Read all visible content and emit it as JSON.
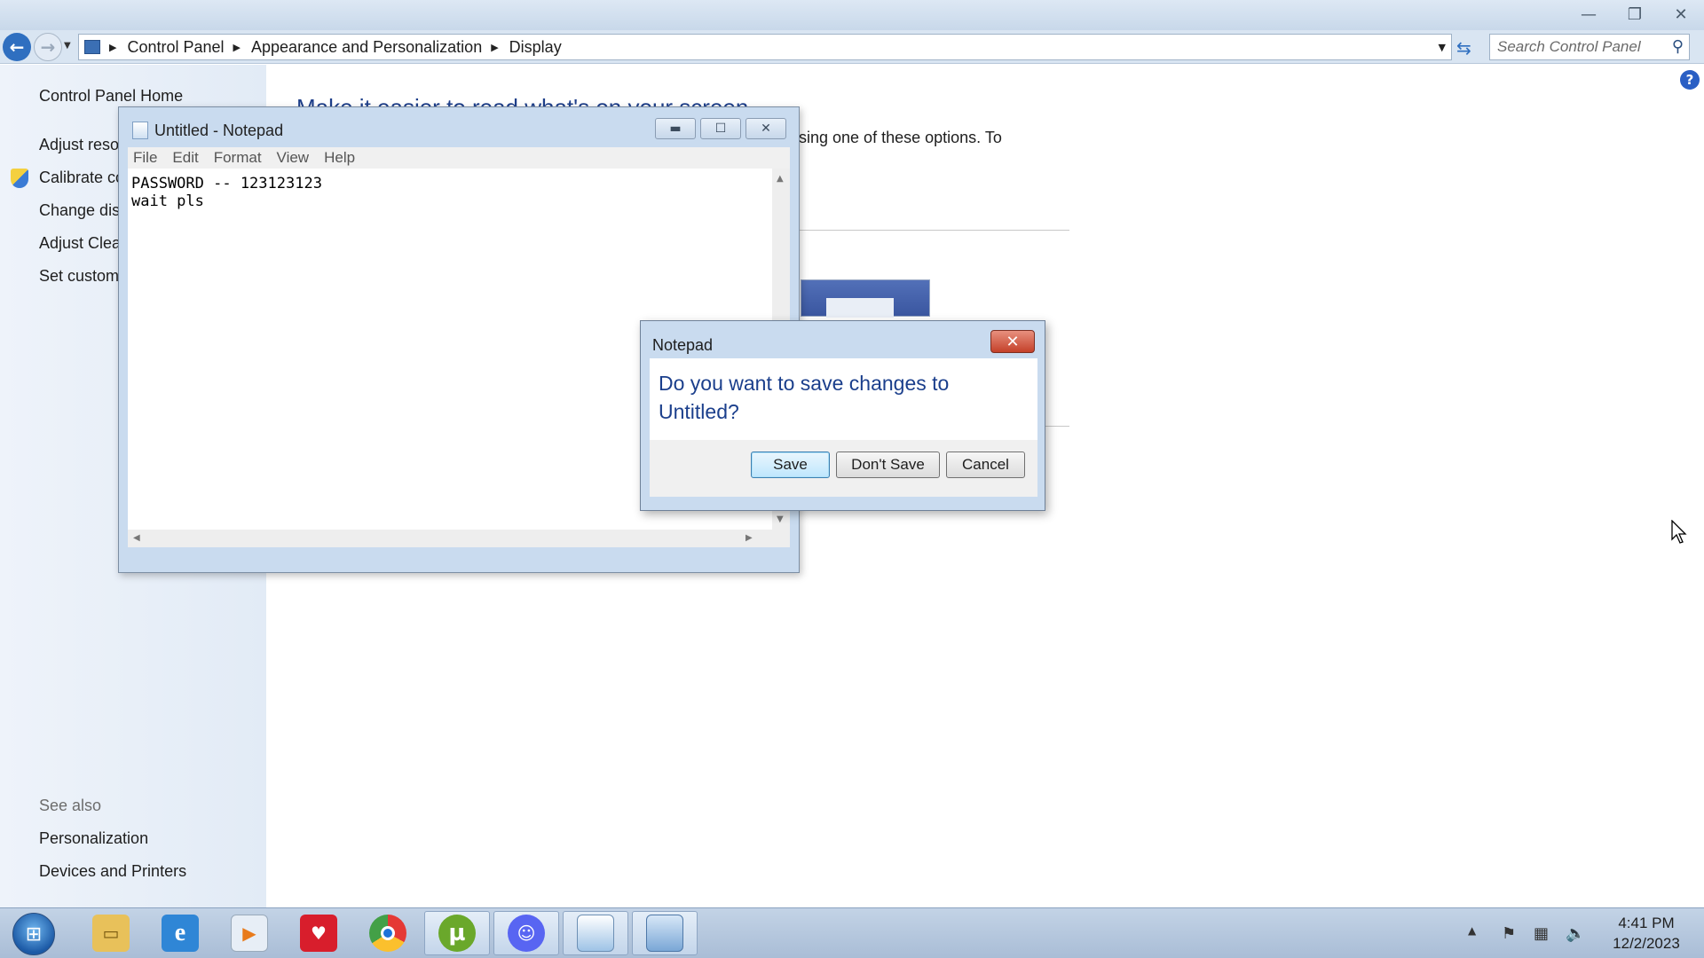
{
  "control_panel": {
    "breadcrumb": [
      "Control Panel",
      "Appearance and Personalization",
      "Display"
    ],
    "search_placeholder": "Search Control Panel",
    "sidebar": {
      "home": "Control Panel Home",
      "links": [
        "Adjust reso",
        "Calibrate co",
        "Change dis",
        "Adjust Clea",
        "Set custom"
      ],
      "see_also_heading": "See also",
      "see_also": [
        "Personalization",
        "Devices and Printers"
      ]
    },
    "main": {
      "heading": "Make it easier to read what's on your screen",
      "text_fragment": "sing one of these options. To"
    }
  },
  "notepad": {
    "title": "Untitled - Notepad",
    "menus": [
      "File",
      "Edit",
      "Format",
      "View",
      "Help"
    ],
    "content": "PASSWORD -- 123123123\nwait pls"
  },
  "dialog": {
    "title": "Notepad",
    "message": "Do you want to save changes to Untitled?",
    "buttons": {
      "save": "Save",
      "dont_save": "Don't Save",
      "cancel": "Cancel"
    }
  },
  "taskbar": {
    "apps": [
      "file-explorer-icon",
      "internet-explorer-icon",
      "media-player-icon",
      "algida-icon",
      "chrome-like-icon",
      "utorrent-icon",
      "discord-icon",
      "notepad-icon",
      "control-panel-icon"
    ],
    "clock_time": "4:41 PM",
    "clock_date": "12/2/2023"
  },
  "colors": {
    "link_heading": "#1e3f8a",
    "dialog_message": "#1b3f8c",
    "close_button": "#c4412a"
  }
}
